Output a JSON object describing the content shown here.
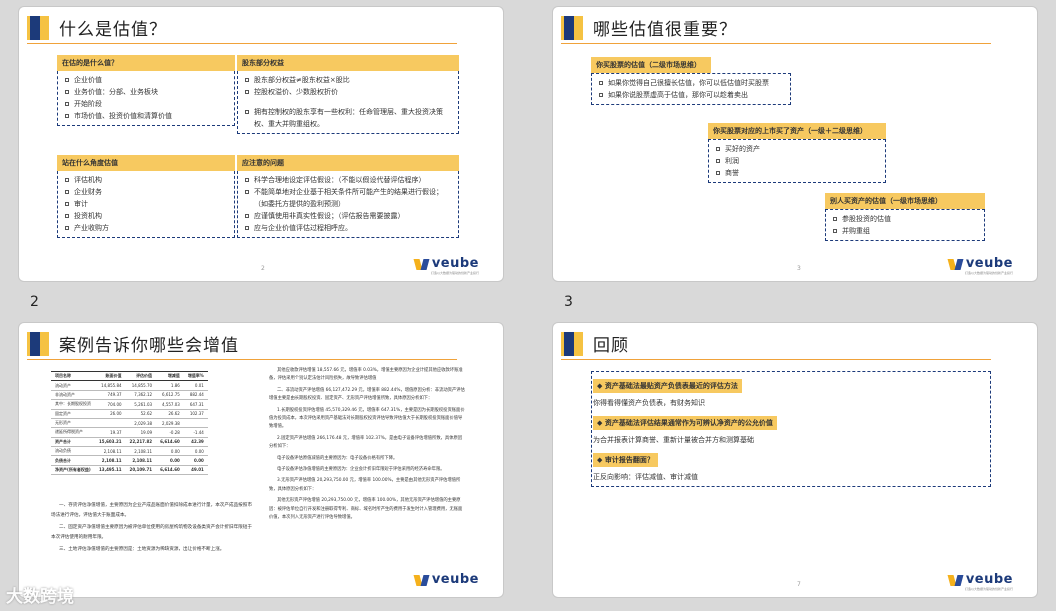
{
  "slides": [
    {
      "title": "什么是估值？",
      "page": "2",
      "boxes": [
        {
          "head": "在估的是什么值？",
          "items": [
            "企业价值",
            "业务价值：分部、业务板块",
            "开始阶段",
            "市场价值、投资价值和清算价值"
          ]
        },
        {
          "head": "股东部分权益",
          "items": [
            "股东部分权益≠股东权益×股比",
            "控股权溢价、少数股权折价",
            "",
            "拥有控制权的股东享有一些权利：任命管理层、重大投资决策权、重大并购重组权。"
          ]
        },
        {
          "head": "站在什么角度估值",
          "items": [
            "评估机构",
            "企业财务",
            "审计",
            "投资机构",
            "产业收购方"
          ]
        },
        {
          "head": "应注意的问题",
          "items": [
            "科学合理地设定评估假设：（不能以假设代替评估程序）",
            "不能简单地对企业基于相关条件所可能产生的结果进行假设；（如委托方提供的盈利预测）",
            "应谨慎使用非真实性假设；（评估报告需要披露）",
            "应与企业价值评估过程相呼应。"
          ]
        }
      ]
    },
    {
      "title": "哪些估值很重要？",
      "page": "3",
      "boxes": [
        {
          "head": "你买股票的估值（二级市场思维）",
          "items": [
            "如果你觉得自己很擅长估值，你可以低估值时买股票",
            "如果你说股票虚高于估值，那你可以趁着卖出"
          ]
        },
        {
          "head": "你买股票对应的上市买了资产（一级＋二级思维）",
          "items": [
            "买好的资产",
            "利润",
            "商誉"
          ]
        },
        {
          "head": "别人买资产的估值（一级市场思维）",
          "items": [
            "参股投资的估值",
            "并购重组"
          ]
        }
      ]
    },
    {
      "title": "案例告诉你哪些会增值",
      "page": "",
      "table": {
        "headers": [
          "项目名称",
          "账面价值",
          "评估价值",
          "增减值",
          "增值率%"
        ],
        "rows": [
          [
            "流动资产",
            "14,855.84",
            "14,855.70",
            "1.86",
            "0.01"
          ],
          [
            "非流动资产",
            "749.37",
            "7,362.12",
            "6,612.75",
            "882.44"
          ],
          [
            "其中：长期股权投资",
            "704.00",
            "5,261.03",
            "4,557.03",
            "647.31"
          ],
          [
            "固定资产",
            "26.00",
            "52.62",
            "26.62",
            "102.37"
          ],
          [
            "无形资产",
            "",
            "2,029.38",
            "2,029.38",
            ""
          ],
          [
            "递延所得税资产",
            "19.37",
            "19.09",
            "-0.28",
            "-1.44"
          ],
          [
            "资产合计",
            "15,603.21",
            "22,217.82",
            "6,614.60",
            "42.39"
          ],
          [
            "流动负债",
            "2,108.11",
            "2,108.11",
            "0.00",
            "0.00"
          ],
          [
            "负债合计",
            "2,108.11",
            "2,108.11",
            "0.00",
            "0.00"
          ],
          [
            "净资产(所有者权益)",
            "13,495.11",
            "20,109.71",
            "6,614.60",
            "49.01"
          ]
        ]
      },
      "left_paras": [
        "一、存货评估净值增值，主要原因为企业产成品账面价值扣除成本进行计量，本次产成品按照市场法进行评估，评估值大于账面成本。",
        "二、固定资产净值增值主要原因为被评估单位使用的房屋构筑物及设备类资产会计折旧年限短于本次评估使用的耐用年限。",
        "三、土地评估净值增值的主要原因是：土地资源为稀缺资源，出让价格不断上涨。"
      ],
      "right_paras": [
        "其他应收款评估增值 18,557.66 元，增值率 0.03%，增值主要原因为企业计提其他应收款坏账准备，评估采用个别认定法估计风险损失，故导致评估增值",
        "二、非流动资产评估增值 66,127,472.29 元，增值率 882.44%，增值原因分析：非流动资产评估增值主要是由长期股权投资、固定资产、无形资产评估增值所致，具体原因分析如下：",
        "1.长期股权投资评估增值 45,570,329.46 元，增值率 647.31%，主要是因为长期股权投资账面价值为投资成本，本次评估采用资产基础法对长期股权投资评估导致评估值大于长期股权投资账面价值导致增值。",
        "2.固定资产评估增值 266,176.48 元，增值率 102.37%，是由电子设备评估增值所致，具体原因分析如下：",
        "电子设备评估原值减值的主要原因为：电子设备价格有所下降。",
        "电子设备评估净值增值的主要原因为：企业会计折旧年限短于评估采用的经济寿命年限。",
        "3.无形资产评估增值 20,293,750.00 元，增值率 100.00%，主要是由其他无形资产评估增值所致，具体原因分析如下：",
        "其他无形资产评估增值 20,293,750.00 元，增值率 100.00%，其他无形资产评估增值的主要原因：被评估单位自行开发和注册取得专利、商标、域名时所产生的费用于发生时计入管理费用，无账面价值，本次列入无形资产进行评估导致增值。"
      ]
    },
    {
      "title": "回顾",
      "page": "7",
      "rows": [
        {
          "text": "◆ 资产基础法最贴资产负债表最近的评估方法",
          "hl": true
        },
        {
          "text": "你得看得懂资产负债表，有财务知识",
          "hl": false
        },
        {
          "text": "◆ 资产基础法评估结果通常作为可辨认净资产的公允价值",
          "hl": true
        },
        {
          "text": "为合并报表计算商誉、重新计量被合并方和测算基础",
          "hl": false
        },
        {
          "text": "◆ 审计报告翻面？",
          "hl": true
        },
        {
          "text": "正反向影响：评估减值、审计减值",
          "hl": false
        }
      ]
    }
  ],
  "slide_labels": [
    "2",
    "3"
  ],
  "logo": {
    "text": "veube",
    "sub": "打造以大数据为驱动的创新产业投行"
  },
  "watermark": "大数跨境"
}
